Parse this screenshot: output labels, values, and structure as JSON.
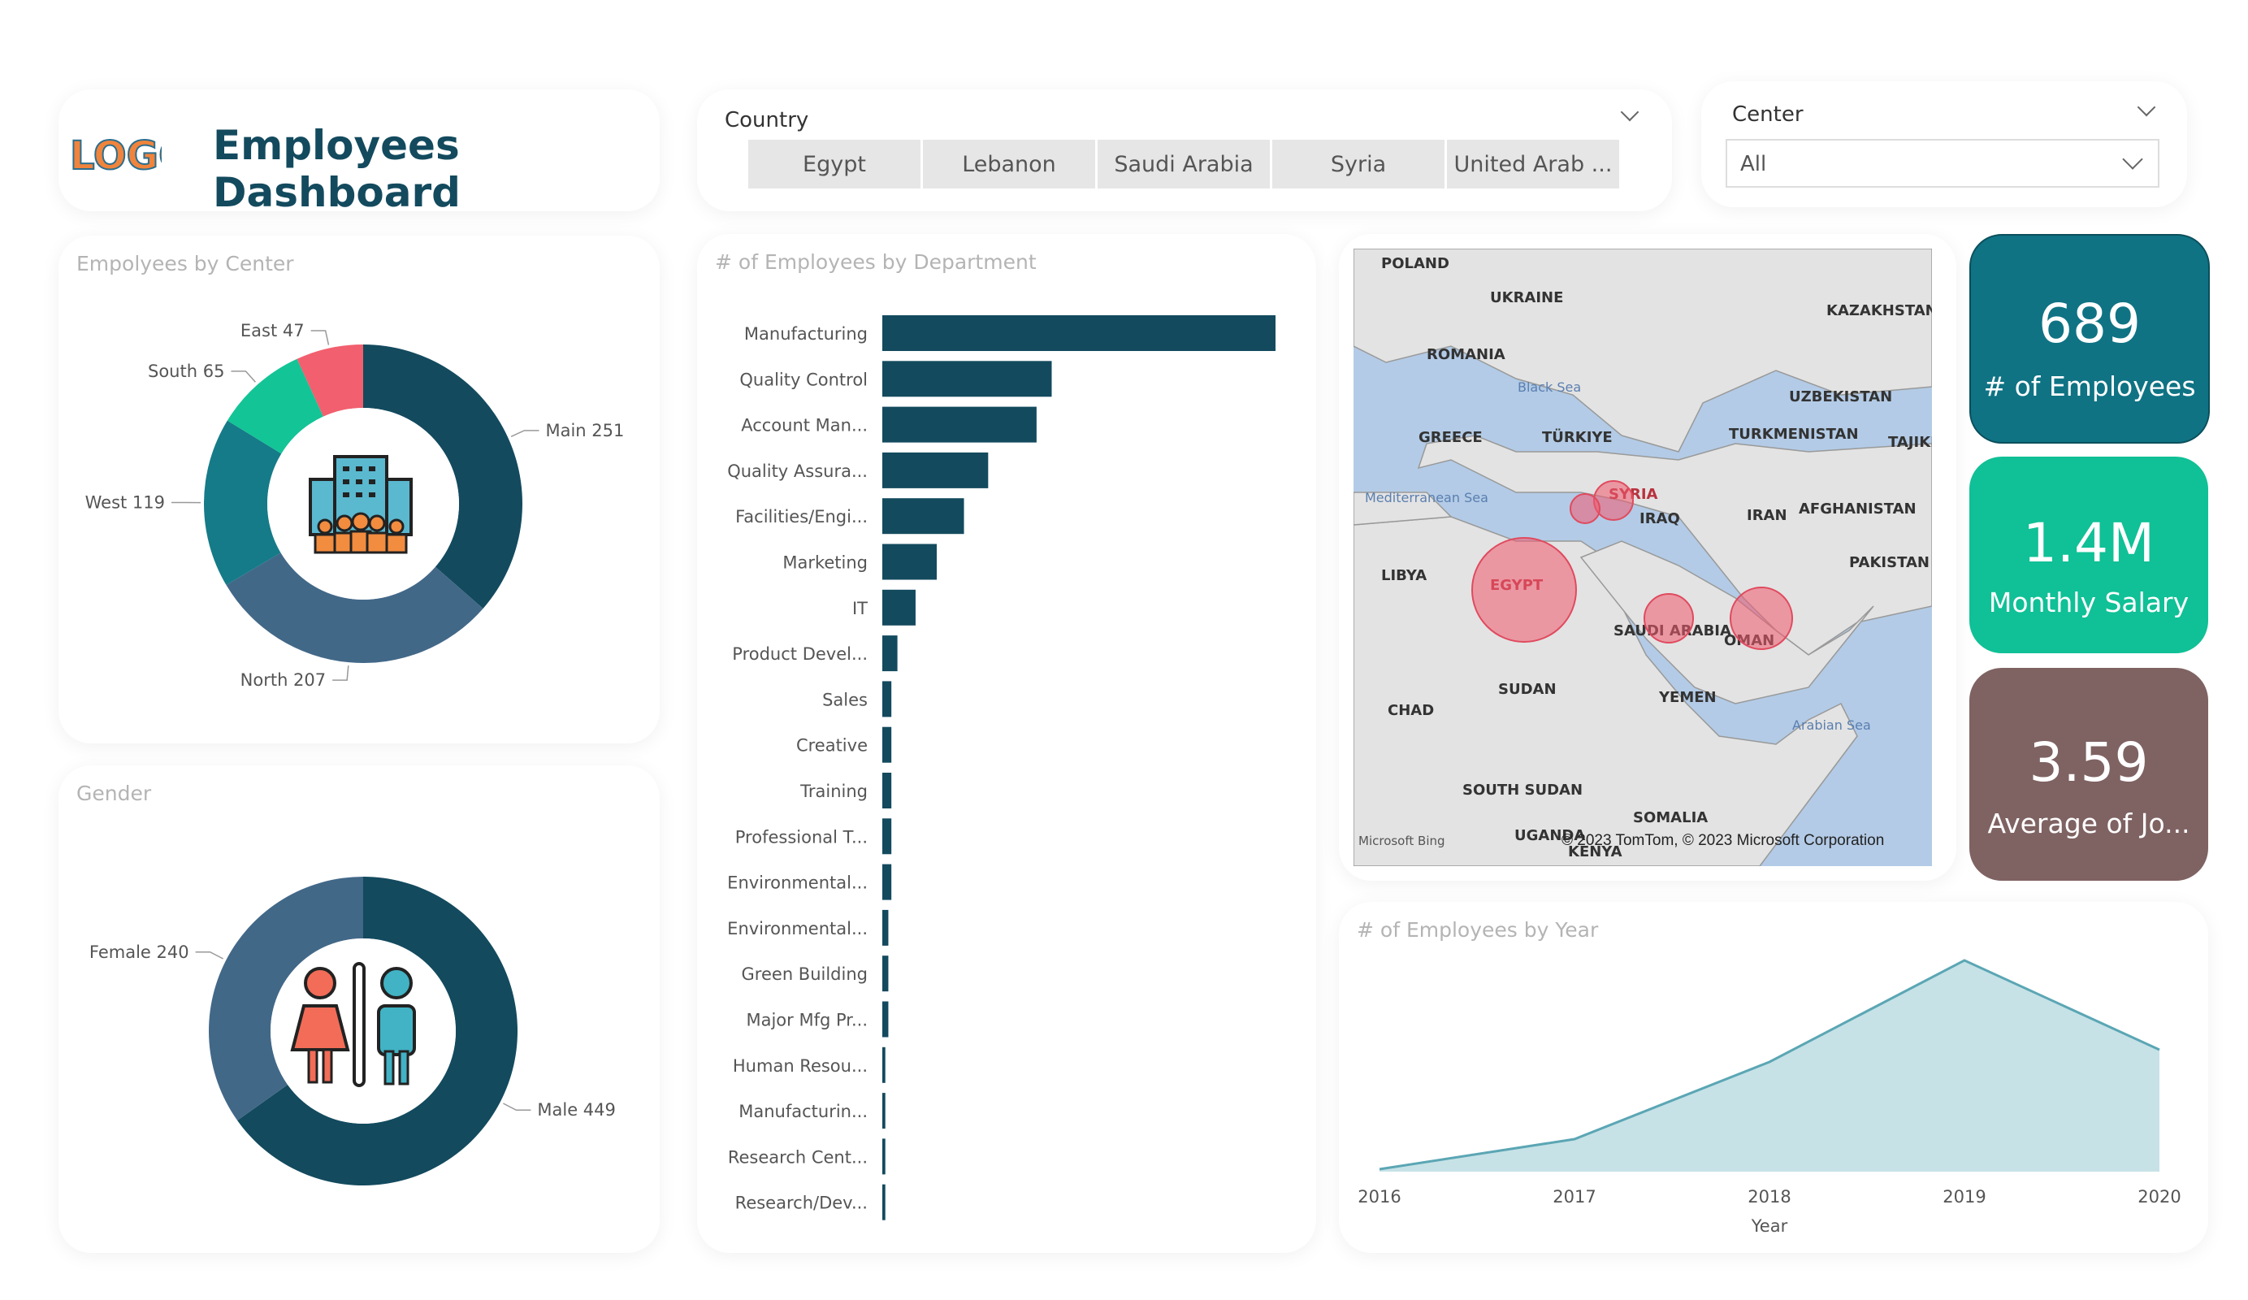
{
  "header": {
    "title": "Employees Dashboard",
    "logo_text": "LOGO"
  },
  "country_filter": {
    "label": "Country",
    "options": [
      "Egypt",
      "Lebanon",
      "Saudi Arabia",
      "Syria",
      "United Arab ..."
    ]
  },
  "center_filter": {
    "label": "Center",
    "value": "All"
  },
  "kpis": [
    {
      "value": "689",
      "label": "# of Employees",
      "color": "#0f7384"
    },
    {
      "value": "1.4M",
      "label": "Monthly Salary",
      "color": "#10c096"
    },
    {
      "value": "3.59",
      "label": "Average of Jo...",
      "color": "#7f6262"
    }
  ],
  "chart_data": [
    {
      "type": "pie",
      "title": "Empolyees by Center",
      "categories": [
        "Main",
        "North",
        "West",
        "South",
        "East"
      ],
      "values": [
        251,
        207,
        119,
        65,
        47
      ],
      "data_labels": [
        "Main 251",
        "North 207",
        "West 119",
        "South 65",
        "East 47"
      ],
      "colors": [
        "#134a5e",
        "#426888",
        "#157b88",
        "#13c496",
        "#f25f6e"
      ]
    },
    {
      "type": "pie",
      "title": "Gender",
      "categories": [
        "Male",
        "Female"
      ],
      "values": [
        449,
        240
      ],
      "data_labels": [
        "Male 449",
        "Female 240"
      ],
      "colors": [
        "#134a5e",
        "#426888"
      ]
    },
    {
      "type": "bar",
      "title": "# of Employees by Department",
      "categories": [
        "Manufacturing",
        "Quality Control",
        "Account Man...",
        "Quality Assura...",
        "Facilities/Engi...",
        "Marketing",
        "IT",
        "Product Devel...",
        "Sales",
        "Creative",
        "Training",
        "Professional T...",
        "Environmental...",
        "Environmental...",
        "Green Building",
        "Major Mfg Pr...",
        "Human Resou...",
        "Manufacturin...",
        "Research Cent...",
        "Research/Dev..."
      ],
      "values": [
        130,
        56,
        51,
        35,
        27,
        18,
        11,
        5,
        3,
        3,
        3,
        3,
        3,
        2,
        2,
        2,
        1,
        1,
        1,
        1
      ],
      "xlim": [
        0,
        130
      ],
      "color": "#134a5e"
    },
    {
      "type": "area",
      "title": "# of Employees by Year",
      "x": [
        "2016",
        "2017",
        "2018",
        "2019",
        "2020"
      ],
      "values": [
        3,
        40,
        135,
        260,
        150
      ],
      "ylim": [
        0,
        260
      ],
      "xlabel": "Year",
      "color": "#5ba6b4"
    }
  ],
  "map": {
    "labels": [
      "POLAND",
      "UKRAINE",
      "KAZAKHSTAN",
      "ROMANIA",
      "Black Sea",
      "UZBEKISTAN",
      "GREECE",
      "TÜRKIYE",
      "TURKMENISTAN",
      "TAJIKI",
      "Mediterranean Sea",
      "SYRIA",
      "IRAQ",
      "IRAN",
      "AFGHANISTAN",
      "LIBYA",
      "EGYPT",
      "PAKISTAN",
      "SAUDI ARABIA",
      "OMAN",
      "SUDAN",
      "CHAD",
      "YEMEN",
      "Arabian Sea",
      "SOUTH SUDAN",
      "SOMALIA",
      "UGANDA",
      "KENYA"
    ],
    "attribution": "© 2023 TomTom, © 2023 Microsoft Corporation",
    "bing": "Microsoft Bing"
  }
}
